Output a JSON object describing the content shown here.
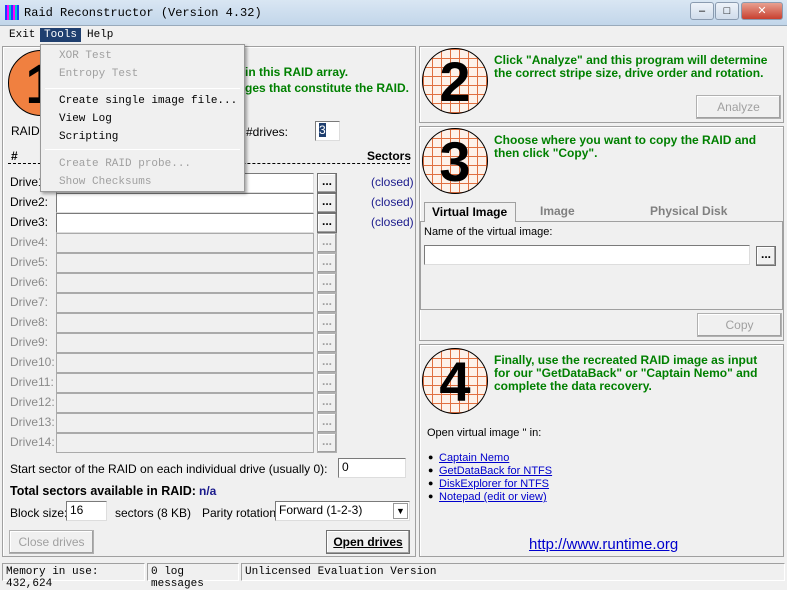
{
  "window": {
    "title": "Raid Reconstructor (Version 4.32)"
  },
  "menubar": {
    "items": [
      "Exit",
      "Tools",
      "Help"
    ]
  },
  "tools_menu": {
    "items": [
      {
        "label": "XOR Test",
        "enabled": false
      },
      {
        "label": "Entropy Test",
        "enabled": false
      },
      {
        "label": "Create single image file...",
        "enabled": true
      },
      {
        "label": "View Log",
        "enabled": true
      },
      {
        "label": "Scripting",
        "enabled": true
      },
      {
        "label": "Create RAID probe...",
        "enabled": false
      },
      {
        "label": "Show Checksums",
        "enabled": false
      }
    ]
  },
  "step1": {
    "number": "1",
    "line1_visible": "in this RAID array.",
    "line2_visible": "ges that constitute the RAID.",
    "raid_label": "RAID",
    "drives_label": "#drives:",
    "drives_value": "3",
    "col_num": "#",
    "col_sectors": "Sectors",
    "drives": [
      {
        "label": "Drive1:",
        "status": "(closed)"
      },
      {
        "label": "Drive2:",
        "status": "(closed)"
      },
      {
        "label": "Drive3:",
        "status": "(closed)"
      },
      {
        "label": "Drive4:"
      },
      {
        "label": "Drive5:"
      },
      {
        "label": "Drive6:"
      },
      {
        "label": "Drive7:"
      },
      {
        "label": "Drive8:"
      },
      {
        "label": "Drive9:"
      },
      {
        "label": "Drive10:"
      },
      {
        "label": "Drive11:"
      },
      {
        "label": "Drive12:"
      },
      {
        "label": "Drive13:"
      },
      {
        "label": "Drive14:"
      }
    ],
    "browse_label": "...",
    "start_sector_label": "Start sector of the RAID on each individual drive (usually 0):",
    "start_sector_value": "0",
    "total_label": "Total sectors available in RAID:",
    "total_value": "n/a",
    "block_size_label": "Block size:",
    "block_size_value": "16",
    "sectors_kb": "sectors (8 KB)",
    "parity_label": "Parity rotation:",
    "parity_value": "Forward (1-2-3)",
    "close_drives": "Close drives",
    "open_drives": "Open drives"
  },
  "step2": {
    "number": "2",
    "text1": "Click \"Analyze\" and this program will determine",
    "text2": "the correct stripe size, drive order and rotation.",
    "analyze": "Analyze"
  },
  "step3": {
    "number": "3",
    "text1": "Choose where you want to copy the RAID and",
    "text2": "then click \"Copy\".",
    "tabs": [
      "Virtual Image",
      "Image",
      "Physical Disk"
    ],
    "name_label": "Name of the virtual image:",
    "name_value": "",
    "browse": "...",
    "copy": "Copy"
  },
  "step4": {
    "number": "4",
    "text1": "Finally, use the recreated RAID image as input",
    "text2": "for our \"GetDataBack\" or \"Captain Nemo\" and",
    "text3": "complete the data recovery.",
    "open_label": "Open virtual image '' in:",
    "links": [
      "Captain Nemo",
      "GetDataBack for NTFS",
      "DiskExplorer for NTFS",
      "Notepad (edit or view)"
    ],
    "url": "http://www.runtime.org"
  },
  "statusbar": {
    "memory": "Memory in use: 432,624",
    "log": "0 log messages",
    "license": "Unlicensed Evaluation Version"
  },
  "colors": {
    "accent_green": "#008000",
    "menu_highlight": "#1f3f6f"
  }
}
